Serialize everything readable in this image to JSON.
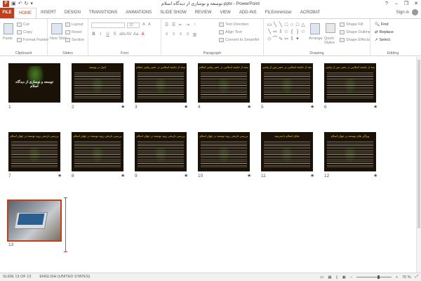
{
  "window": {
    "title": "توسعه و نوسازی از دیدگاه اسلام.pptx - PowerPoint",
    "qat_logo": "P",
    "minimize": "–",
    "restore": "❐",
    "close": "✕",
    "help": "?"
  },
  "tabs": [
    "FILE",
    "HOME",
    "INSERT",
    "DESIGN",
    "TRANSITIONS",
    "ANIMATIONS",
    "SLIDE SHOW",
    "REVIEW",
    "VIEW",
    "ADD-INS",
    "FILEminimizer",
    "ACROBAT"
  ],
  "active_tab": "HOME",
  "signin": "Sign in",
  "ribbon": {
    "clipboard": {
      "label": "Clipboard",
      "paste": "Paste",
      "cut": "Cut",
      "copy": "Copy",
      "format_painter": "Format Painter"
    },
    "slides": {
      "label": "Slides",
      "new_slide": "New Slide",
      "layout": "Layout",
      "reset": "Reset",
      "section": "Section"
    },
    "font": {
      "label": "Font",
      "size": "32",
      "bold": "B",
      "italic": "I",
      "underline": "U",
      "strike": "S",
      "shadow": "abc",
      "spacing": "AV",
      "case": "Aa",
      "font_color": "A"
    },
    "paragraph": {
      "label": "Paragraph",
      "text_direction": "Text Direction",
      "align_text": "Align Text",
      "convert": "Convert to SmartArt"
    },
    "drawing": {
      "label": "Drawing",
      "arrange": "Arrange",
      "quick_styles": "Quick Styles",
      "shape_fill": "Shape Fill",
      "shape_outline": "Shape Outline",
      "shape_effects": "Shape Effects"
    },
    "editing": {
      "label": "Editing",
      "find": "Find",
      "replace": "Replace",
      "select": "Select"
    }
  },
  "slides": [
    {
      "num": "1",
      "title": "توسعه و نوسازی از دیدگاه اسلام",
      "kind": "title"
    },
    {
      "num": "2",
      "title": "اصل در توسعه",
      "kind": "text"
    },
    {
      "num": "3",
      "title": "توسعه از جامعه اسلامی در عصر پیامبر اسلام",
      "kind": "text"
    },
    {
      "num": "4",
      "title": "توسعه از جامعه اسلامی در عصر پیامبر اسلام",
      "kind": "text"
    },
    {
      "num": "5",
      "title": "توسعه از جامعه اسلامی در عصر پس از پیامبر",
      "kind": "text"
    },
    {
      "num": "6",
      "title": "توسعه از جامعه اسلامی در عصر پس از پیامبر",
      "kind": "text"
    },
    {
      "num": "7",
      "title": "بررسی تاریخی روند توسعه در جهان اسلام",
      "kind": "text"
    },
    {
      "num": "8",
      "title": "بررسی تاریخی روند توسعه در جهان اسلام",
      "kind": "text"
    },
    {
      "num": "9",
      "title": "بررسی تاریخی روند توسعه در جهان اسلام",
      "kind": "text"
    },
    {
      "num": "10",
      "title": "بررسی تاریخی روند توسعه در جهان اسلام",
      "kind": "text"
    },
    {
      "num": "11",
      "title": "تقابل اسلام با مدرنیته",
      "kind": "text"
    },
    {
      "num": "12",
      "title": "ویژگی های توسعه در جهان اسلام",
      "kind": "text"
    },
    {
      "num": "13",
      "title": "",
      "kind": "photo"
    }
  ],
  "status": {
    "slide": "SLIDE 13 OF 13",
    "language": "ENGLISH (UNITED STATES)",
    "zoom": "70 %"
  }
}
